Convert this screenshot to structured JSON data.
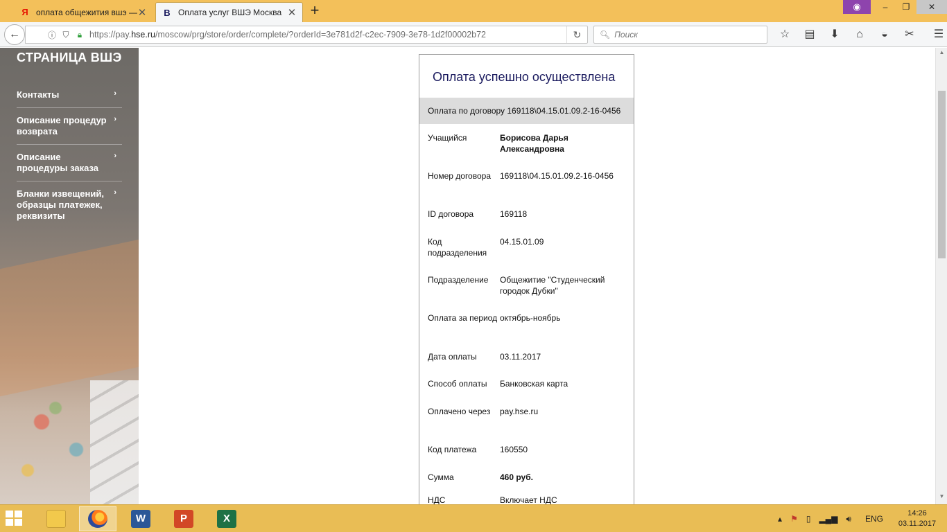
{
  "browser": {
    "tabs": [
      {
        "title": "оплата общежития вшэ —",
        "favicon": "Я",
        "active": false
      },
      {
        "title": "Оплата услуг ВШЭ Москва",
        "favicon": "В",
        "active": true
      }
    ],
    "url_prefix": "https://pay.",
    "url_host": "hse.ru",
    "url_path": "/moscow/prg/store/order/complete/?orderId=3e781d2f-c2ec-7909-3e78-1d2f00002b72",
    "search_placeholder": "Поиск",
    "window_buttons": [
      "–",
      "❐",
      "✕"
    ],
    "private_icon": "mask-icon"
  },
  "sidebar": {
    "title": "СТРАНИЦА ВШЭ",
    "items": [
      {
        "label": "Контакты"
      },
      {
        "label": "Описание процедур возврата"
      },
      {
        "label": "Описание процедуры заказа"
      },
      {
        "label": "Бланки извещений, образцы платежек, реквизиты"
      }
    ]
  },
  "card": {
    "title": "Оплата успешно осуществлена",
    "subtitle": "Оплата по договору 169118\\04.15.01.09.2-16-0456",
    "rows": [
      {
        "key": "Учащийся",
        "value": "Борисова Дарья Александровна",
        "bold": true
      },
      {
        "key": "Номер договора",
        "value": "169118\\04.15.01.09.2-16-0456"
      },
      {
        "key": "ID договора",
        "value": "169118"
      },
      {
        "key": "Код подразделения",
        "value": "04.15.01.09"
      },
      {
        "key": "Подразделение",
        "value": "Общежитие \"Студенческий городок Дубки\""
      },
      {
        "key": "Оплата за период",
        "value": "октябрь-ноябрь"
      },
      {
        "key": "Дата оплаты",
        "value": "03.11.2017"
      },
      {
        "key": "Способ оплаты",
        "value": "Банковская карта"
      },
      {
        "key": "Оплачено через",
        "value": "pay.hse.ru"
      },
      {
        "key": "Код платежа",
        "value": "160550"
      },
      {
        "key": "Сумма",
        "value": "460 руб.",
        "bold": true
      },
      {
        "key": "НДС",
        "value": "Включает НДС"
      }
    ]
  },
  "taskbar": {
    "apps": [
      {
        "name": "explorer",
        "label": ""
      },
      {
        "name": "firefox",
        "label": ""
      },
      {
        "name": "word",
        "label": "W",
        "color": "#2b5797"
      },
      {
        "name": "powerpoint",
        "label": "P",
        "color": "#d24726"
      },
      {
        "name": "excel",
        "label": "X",
        "color": "#1e7145"
      }
    ],
    "language": "ENG",
    "time": "14:26",
    "date": "03.11.2017"
  }
}
